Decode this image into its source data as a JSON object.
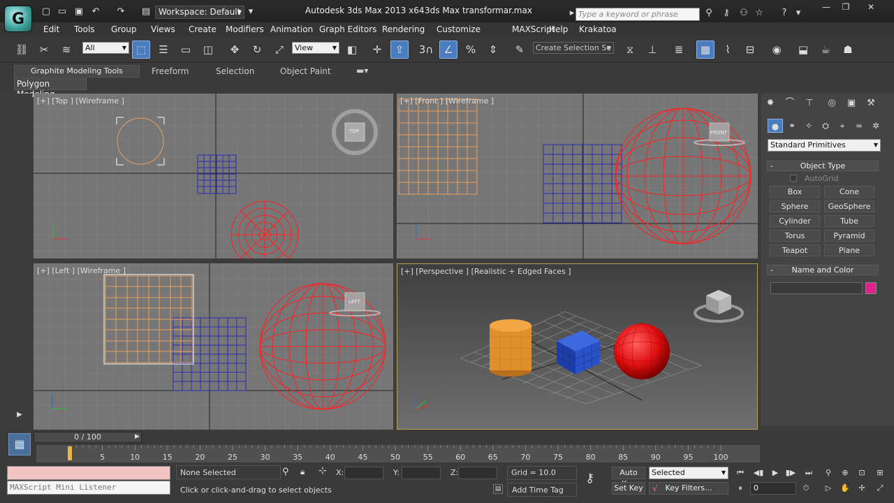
{
  "app": {
    "workspace_label": "Workspace: Default",
    "title": "Autodesk 3ds Max  2013 x64",
    "file": "3ds Max transformar.max",
    "search_placeholder": "Type a keyword or phrase",
    "logo_text": "G"
  },
  "menu": [
    "Edit",
    "Tools",
    "Group",
    "Views",
    "Create",
    "Modifiers",
    "Animation",
    "Graph Editors",
    "Rendering",
    "Customize",
    "MAXScript",
    "Help",
    "Krakatoa"
  ],
  "toolbar": {
    "filter": "All",
    "ref_coord": "View",
    "selection_set": "Create Selection Se",
    "snap_label": "3"
  },
  "ribbon": {
    "tabs": [
      "Graphite Modeling Tools",
      "Freeform",
      "Selection",
      "Object Paint"
    ],
    "panel": "Polygon Modeling"
  },
  "viewports": {
    "top": "[+] [Top ] [Wireframe ]",
    "front": "[+] [Front ] [Wireframe ]",
    "left": "[+] [Left ] [Wireframe ]",
    "perspective": "[+] [Perspective ] [Realistic + Edged Faces ]",
    "viewcube_top": "TOP",
    "viewcube_front": "FRONT",
    "viewcube_left": "LEFT"
  },
  "command_panel": {
    "category": "Standard Primitives",
    "object_type_header": "Object Type",
    "autogrid": "AutoGrid",
    "buttons": [
      "Box",
      "Cone",
      "Sphere",
      "GeoSphere",
      "Cylinder",
      "Tube",
      "Torus",
      "Pyramid",
      "Teapot",
      "Plane"
    ],
    "name_color_header": "Name and Color",
    "object_color": "#e0218a"
  },
  "timeline": {
    "frame": "0 / 100",
    "ticks": [
      "0",
      "5",
      "10",
      "15",
      "20",
      "25",
      "30",
      "35",
      "40",
      "45",
      "50",
      "55",
      "60",
      "65",
      "70",
      "75",
      "80",
      "85",
      "90",
      "95",
      "100"
    ]
  },
  "status": {
    "listener": "MAXScript Mini Listener",
    "selection": "None Selected",
    "prompt": "Click or click-and-drag to select objects",
    "x_label": "X:",
    "y_label": "Y:",
    "z_label": "Z:",
    "grid": "Grid = 10.0",
    "add_time_tag": "Add Time Tag",
    "auto_key": "Auto Key",
    "set_key": "Set Key",
    "key_mode": "Selected",
    "key_filters": "Key Filters...",
    "current_frame": "0"
  },
  "colors": {
    "wire_red": "#ff2020",
    "wire_orange": "#e8a060",
    "wire_blue": "#2a2ab0",
    "active_border": "#b8a24b",
    "accent_blue": "#4a7dbf"
  }
}
